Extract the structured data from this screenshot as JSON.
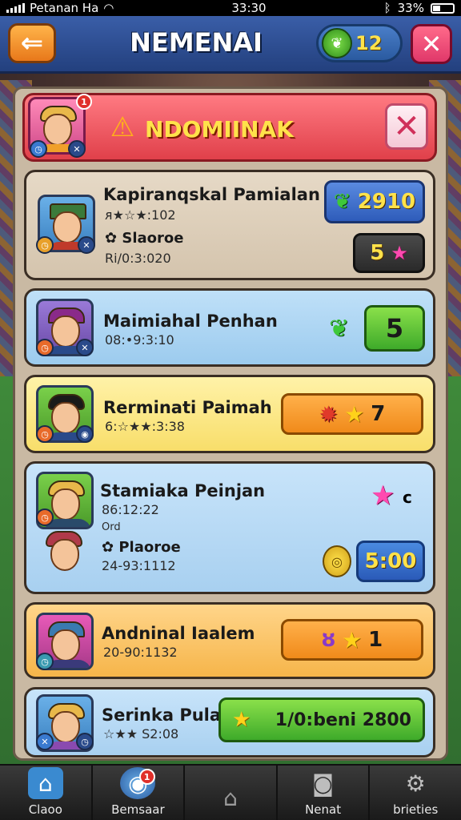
{
  "status_bar": {
    "carrier": "Petanan Ha",
    "time": "33:30",
    "battery": "33%"
  },
  "header": {
    "title": "NEMENAI",
    "currency_value": "12",
    "back_icon": "arrow-left-icon",
    "close_icon": "close-icon"
  },
  "alert": {
    "text": "NDOMIINAK",
    "badge_count": "1",
    "icon": "warning-icon"
  },
  "players": [
    {
      "name": "Kapiranqskal Pamialan",
      "stat1": "ᴙ★☆★:102",
      "stat2": "Slaoroe",
      "stat3": "Ri/0:3:020",
      "reward_primary": "2910",
      "reward_secondary": "5",
      "primary_icon": "leaf-icon",
      "secondary_icon": "star-icon"
    },
    {
      "name": "Maimiahal Penhan",
      "stat1": "08:•9:3:10",
      "reward_primary": "5",
      "primary_icon": "leaf-icon"
    },
    {
      "name": "Rerminati Paimah",
      "stat1": "6:☆★★:3:38",
      "reward_primary": "7",
      "primary_icon": "gear-icon",
      "secondary_icon": "star-icon"
    },
    {
      "name": "Stamiaka Peinjan",
      "stat1": "86:12:22",
      "stat2": "Ord",
      "stat3": "Plaoroe",
      "stat4": "24-93:1112",
      "reward_primary": "5:00",
      "reward_badge": "c",
      "primary_icon": "coin-icon",
      "secondary_icon": "pink-star-icon"
    },
    {
      "name": "Andninal Iaalem",
      "stat1": "20-90:1132",
      "reward_primary": "1",
      "primary_icon": "star-icon",
      "secondary_icon": "potion-icon"
    },
    {
      "name": "Serinka Pula",
      "stat1": "☆★★ S2:08",
      "reward_primary": "1/0:beni 2800",
      "primary_icon": "star-icon"
    }
  ],
  "bottom_nav": [
    {
      "label": "Claoo",
      "icon": "home-icon"
    },
    {
      "label": "Bemsaar",
      "icon": "disc-icon",
      "badge": "1"
    },
    {
      "label": "",
      "icon": "house-outline-icon"
    },
    {
      "label": "Nenat",
      "icon": "camera-icon"
    },
    {
      "label": "brieties",
      "icon": "gear-icon"
    }
  ],
  "colors": {
    "header": "#2e4f96",
    "alert": "#e84a54",
    "accent_yellow": "#ffe24a"
  }
}
